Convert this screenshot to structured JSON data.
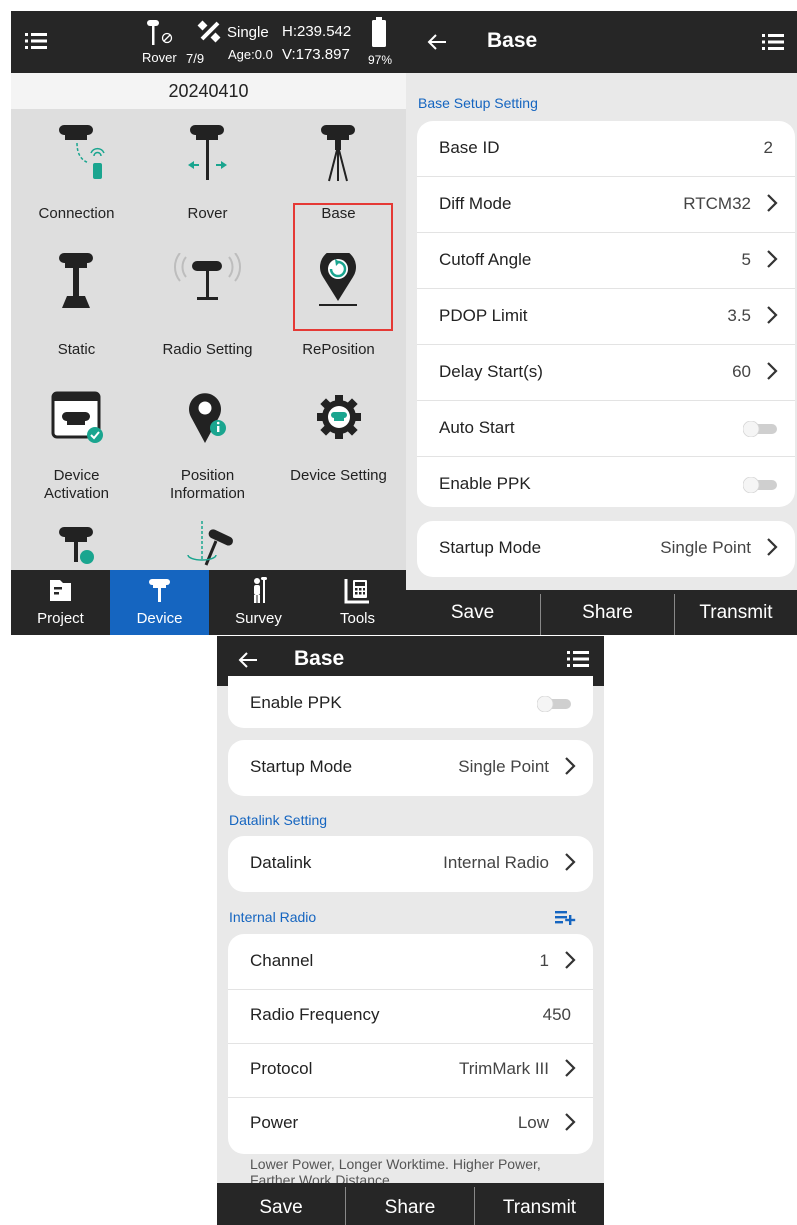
{
  "status_bar": {
    "rover_label": "Rover",
    "sats": "7/9",
    "solution": "Single",
    "age": "Age:0.0",
    "h_value": "H:239.542",
    "v_value": "V:173.897",
    "battery": "97%"
  },
  "project_date": "20240410",
  "device_menu": [
    {
      "label": "Connection",
      "icon": "connection-icon"
    },
    {
      "label": "Rover",
      "icon": "rover-icon"
    },
    {
      "label": "Base",
      "icon": "base-icon",
      "highlighted": true
    },
    {
      "label": "Static",
      "icon": "static-icon"
    },
    {
      "label": "Radio Setting",
      "icon": "radio-setting-icon"
    },
    {
      "label": "RePosition",
      "icon": "reposition-icon"
    },
    {
      "label": "Device\nActivation",
      "icon": "device-activation-icon"
    },
    {
      "label": "Position\nInformation",
      "icon": "position-information-icon"
    },
    {
      "label": "Device Setting",
      "icon": "device-setting-icon"
    }
  ],
  "bottom_tabs": [
    {
      "label": "Project",
      "icon": "project-icon"
    },
    {
      "label": "Device",
      "icon": "device-icon",
      "active": true
    },
    {
      "label": "Survey",
      "icon": "survey-icon"
    },
    {
      "label": "Tools",
      "icon": "tools-icon"
    }
  ],
  "base_screen": {
    "title": "Base",
    "section_setup": "Base Setup Setting",
    "rows": [
      {
        "label": "Base ID",
        "value": "2",
        "chevron": false
      },
      {
        "label": "Diff Mode",
        "value": "RTCM32",
        "chevron": true
      },
      {
        "label": "Cutoff Angle",
        "value": "5",
        "chevron": true
      },
      {
        "label": "PDOP Limit",
        "value": "3.5",
        "chevron": true
      },
      {
        "label": "Delay Start(s)",
        "value": "60",
        "chevron": true
      },
      {
        "label": "Auto Start",
        "toggle": false
      },
      {
        "label": "Enable PPK",
        "toggle": false
      }
    ],
    "startup_mode": {
      "label": "Startup Mode",
      "value": "Single Point"
    },
    "section_datalink": "Datalink Setting",
    "datalink": {
      "label": "Datalink",
      "value": "Internal Radio"
    },
    "section_internal_radio": "Internal Radio",
    "radio_rows": [
      {
        "label": "Channel",
        "value": "1",
        "chevron": true
      },
      {
        "label": "Radio Frequency",
        "value": "450",
        "chevron": false
      },
      {
        "label": "Protocol",
        "value": "TrimMark III",
        "chevron": true
      },
      {
        "label": "Power",
        "value": "Low",
        "chevron": true
      }
    ],
    "power_note_line1": "Lower Power, Longer Worktime. Higher Power,",
    "power_note_line2": "Farther Work Distance",
    "buttons": {
      "save": "Save",
      "share": "Share",
      "transmit": "Transmit"
    }
  },
  "colors": {
    "accent": "#1565c0",
    "highlight": "#e53935",
    "dark_bar": "#262626",
    "icon_teal": "#1aa58f"
  }
}
